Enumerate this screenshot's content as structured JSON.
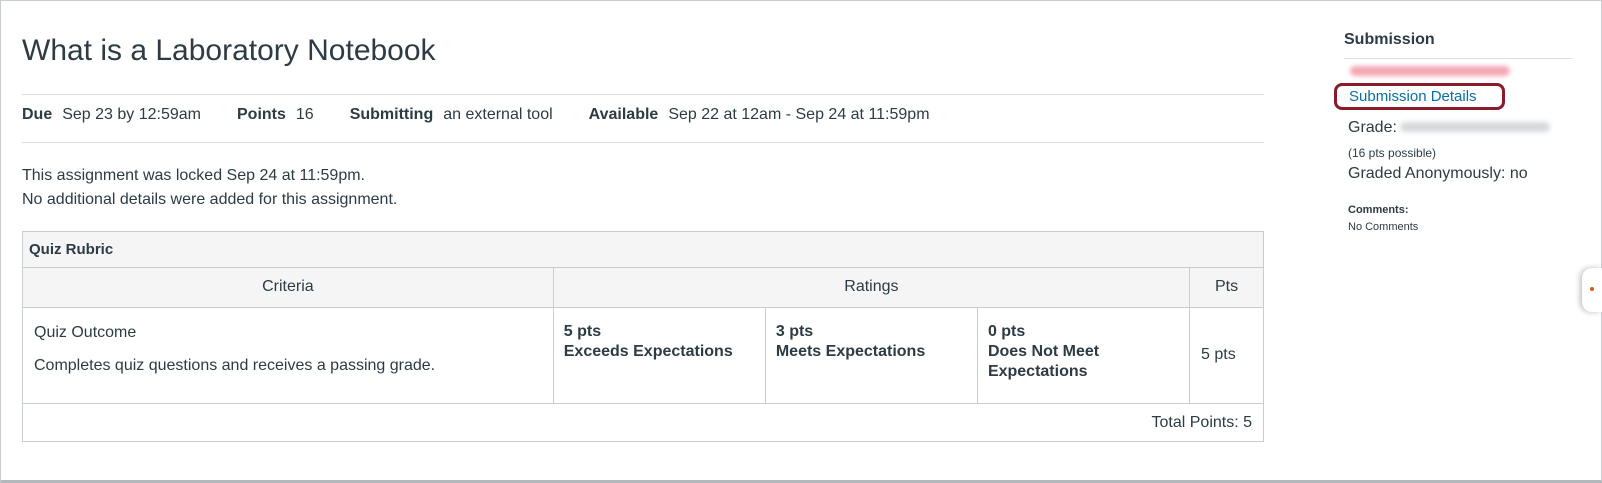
{
  "assignment": {
    "title": "What is a Laboratory Notebook",
    "due_label": "Due",
    "due_value": "Sep 23 by 12:59am",
    "points_label": "Points",
    "points_value": "16",
    "submitting_label": "Submitting",
    "submitting_value": "an external tool",
    "available_label": "Available",
    "available_value": "Sep 22 at 12am - Sep 24 at 11:59pm",
    "locked_message": "This assignment was locked Sep 24 at 11:59pm.",
    "details_message": "No additional details were added for this assignment."
  },
  "rubric": {
    "title": "Quiz Rubric",
    "headers": {
      "criteria": "Criteria",
      "ratings": "Ratings",
      "pts": "Pts"
    },
    "criterion": {
      "name": "Quiz Outcome",
      "description": "Completes quiz questions and receives a passing grade.",
      "ratings": [
        {
          "points": "5 pts",
          "label": "Exceeds Expectations"
        },
        {
          "points": "3 pts",
          "label": "Meets Expectations"
        },
        {
          "points": "0 pts",
          "label": "Does Not Meet Expectations"
        }
      ],
      "pts": "5 pts"
    },
    "total": "Total Points: 5"
  },
  "sidebar": {
    "title": "Submission",
    "details_link": "Submission Details",
    "grade_label": "Grade:",
    "pts_possible": "(16 pts possible)",
    "graded_anonymously": "Graded Anonymously: no",
    "comments_label": "Comments:",
    "comments_value": "No Comments"
  },
  "colors": {
    "link": "#0770a3",
    "highlight_border": "#8b1a2b",
    "text": "#2d3b45",
    "redacted_pink": "#f4a6b4",
    "redacted_gray": "#d6d9dc"
  }
}
